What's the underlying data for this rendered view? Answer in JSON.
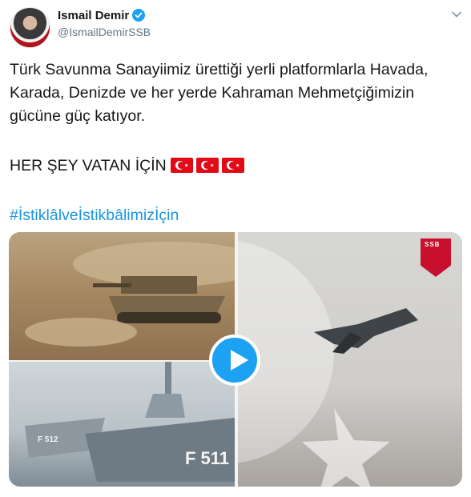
{
  "author": {
    "name": "Ismail Demir",
    "handle": "@IsmailDemirSSB"
  },
  "tweet": {
    "paragraph1": "Türk Savunma Sanayiimiz ürettiği yerli platformlarla Havada, Karada, Denizde ve her yerde Kahraman Mehmetçiğimizin gücüne güç katıyor.",
    "paragraph2": "HER ŞEY VATAN İÇİN",
    "hashtag": "#İstiklâlveİstikbâlimizİçin"
  },
  "media": {
    "logo_text": "SSB",
    "hull_number_1": "F 512",
    "hull_number_2": "F 511"
  },
  "colors": {
    "link": "#1b95e0",
    "verified": "#1da1f2",
    "flag_red": "#e30a17"
  }
}
